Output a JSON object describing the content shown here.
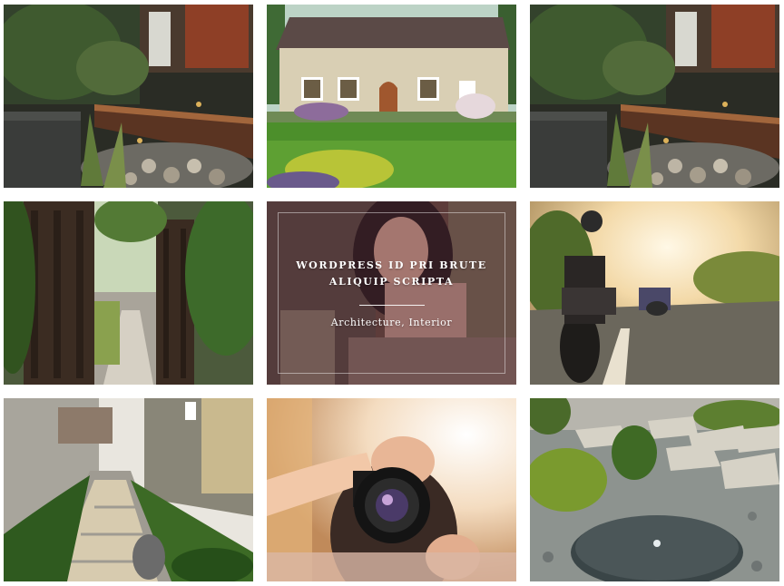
{
  "gallery": {
    "items": [
      {
        "label": "garden-deck-night"
      },
      {
        "label": "stone-cottage"
      },
      {
        "label": "garden-deck-night"
      },
      {
        "label": "wooden-gate-path"
      },
      {
        "label": "woman-portrait",
        "hover": {
          "title": "WORDPRESS ID PRI BRUTE ALIQUIP SCRIPTA",
          "categories": "Architecture, Interior"
        }
      },
      {
        "label": "motorcycle-sunset"
      },
      {
        "label": "stepping-stone-walkway"
      },
      {
        "label": "photographer-camera"
      },
      {
        "label": "garden-fountain"
      }
    ]
  }
}
